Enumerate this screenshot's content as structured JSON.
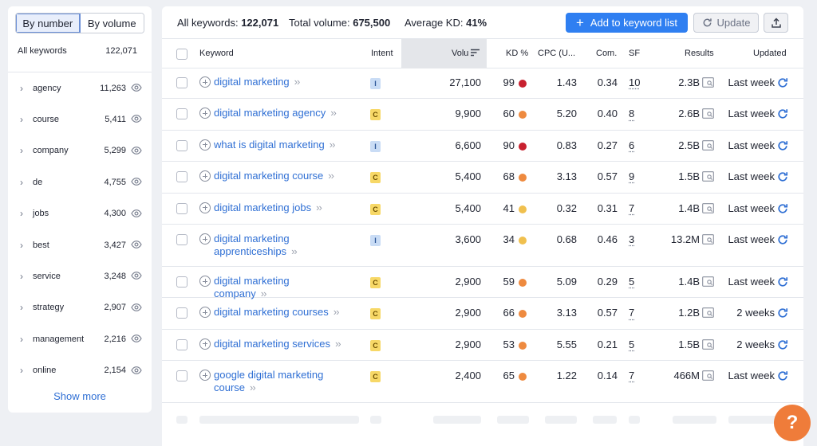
{
  "sidebar": {
    "tabs": [
      "By number",
      "By volume"
    ],
    "all_label": "All keywords",
    "all_count": "122,071",
    "groups": [
      {
        "name": "agency",
        "count": "11,263"
      },
      {
        "name": "course",
        "count": "5,411"
      },
      {
        "name": "company",
        "count": "5,299"
      },
      {
        "name": "de",
        "count": "4,755"
      },
      {
        "name": "jobs",
        "count": "4,300"
      },
      {
        "name": "best",
        "count": "3,427"
      },
      {
        "name": "service",
        "count": "3,248"
      },
      {
        "name": "strategy",
        "count": "2,907"
      },
      {
        "name": "management",
        "count": "2,216"
      },
      {
        "name": "online",
        "count": "2,154"
      }
    ],
    "show_more": "Show more"
  },
  "summary": {
    "all_label": "All keywords:",
    "all_value": "122,071",
    "volume_label": "Total volume:",
    "volume_value": "675,500",
    "kd_label": "Average KD:",
    "kd_value": "41%"
  },
  "actions": {
    "add": "Add to keyword list",
    "update": "Update"
  },
  "table": {
    "headers": {
      "keyword": "Keyword",
      "intent": "Intent",
      "volume": "Volu",
      "kd": "KD %",
      "cpc": "CPC (U...",
      "com": "Com.",
      "sf": "SF",
      "results": "Results",
      "updated": "Updated"
    },
    "rows": [
      {
        "keyword": "digital marketing",
        "intent": "I",
        "volume": "27,100",
        "kd": "99",
        "kd_color": "#c8202f",
        "cpc": "1.43",
        "com": "0.34",
        "sf": "10",
        "results": "2.3B",
        "updated": "Last week"
      },
      {
        "keyword": "digital marketing agency",
        "intent": "C",
        "volume": "9,900",
        "kd": "60",
        "kd_color": "#ee8a3f",
        "cpc": "5.20",
        "com": "0.40",
        "sf": "8",
        "results": "2.6B",
        "updated": "Last week"
      },
      {
        "keyword": "what is digital marketing",
        "intent": "I",
        "volume": "6,600",
        "kd": "90",
        "kd_color": "#c8202f",
        "cpc": "0.83",
        "com": "0.27",
        "sf": "6",
        "results": "2.5B",
        "updated": "Last week"
      },
      {
        "keyword": "digital marketing course",
        "intent": "C",
        "volume": "5,400",
        "kd": "68",
        "kd_color": "#ee8a3f",
        "cpc": "3.13",
        "com": "0.57",
        "sf": "9",
        "results": "1.5B",
        "updated": "Last week"
      },
      {
        "keyword": "digital marketing jobs",
        "intent": "C",
        "volume": "5,400",
        "kd": "41",
        "kd_color": "#f0c04e",
        "cpc": "0.32",
        "com": "0.31",
        "sf": "7",
        "results": "1.4B",
        "updated": "Last week"
      },
      {
        "keyword": "digital marketing apprenticeships",
        "intent": "I",
        "volume": "3,600",
        "kd": "34",
        "kd_color": "#f0c04e",
        "cpc": "0.68",
        "com": "0.46",
        "sf": "3",
        "results": "13.2M",
        "updated": "Last week"
      },
      {
        "keyword": "digital marketing company",
        "intent": "C",
        "volume": "2,900",
        "kd": "59",
        "kd_color": "#ee8a3f",
        "cpc": "5.09",
        "com": "0.29",
        "sf": "5",
        "results": "1.4B",
        "updated": "Last week"
      },
      {
        "keyword": "digital marketing courses",
        "intent": "C",
        "volume": "2,900",
        "kd": "66",
        "kd_color": "#ee8a3f",
        "cpc": "3.13",
        "com": "0.57",
        "sf": "7",
        "results": "1.2B",
        "updated": "2 weeks"
      },
      {
        "keyword": "digital marketing services",
        "intent": "C",
        "volume": "2,900",
        "kd": "53",
        "kd_color": "#ee8a3f",
        "cpc": "5.55",
        "com": "0.21",
        "sf": "5",
        "results": "1.5B",
        "updated": "2 weeks"
      },
      {
        "keyword": "google digital marketing course",
        "intent": "C",
        "volume": "2,400",
        "kd": "65",
        "kd_color": "#ee8a3f",
        "cpc": "1.22",
        "com": "0.14",
        "sf": "7",
        "results": "466M",
        "updated": "Last week"
      }
    ]
  },
  "help": "?"
}
